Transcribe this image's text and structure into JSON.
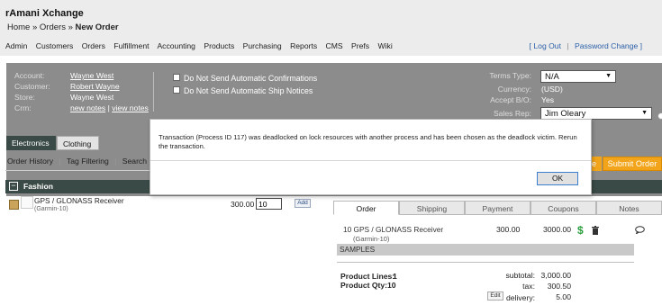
{
  "app": {
    "title": "rAmani Xchange"
  },
  "breadcrumb": {
    "home": "Home",
    "sep1": "»",
    "orders": "Orders",
    "sep2": "»",
    "current": "New Order"
  },
  "nav": {
    "items": [
      "Admin",
      "Customers",
      "Orders",
      "Fulfillment",
      "Accounting",
      "Products",
      "Purchasing",
      "Reports",
      "CMS",
      "Prefs",
      "Wiki"
    ],
    "logout": "[ Log Out",
    "sep": "|",
    "password_change": "Password Change ]"
  },
  "account": {
    "account_label": "Account:",
    "account_value": "Wayne West",
    "customer_label": "Customer:",
    "customer_value": "Robert Wayne",
    "store_label": "Store:",
    "store_value": "Wayne West",
    "crm_label": "Crm:",
    "new_notes": "new notes",
    "crm_sep": "|",
    "view_notes": "view notes"
  },
  "options": {
    "no_confirmations": "Do Not Send Automatic Confirmations",
    "no_ship_notices": "Do Not Send Automatic Ship Notices"
  },
  "terms": {
    "terms_type_label": "Terms Type:",
    "terms_type_value": "N/A",
    "currency_label": "Currency:",
    "currency_value": "(USD)",
    "accept_bo_label": "Accept B/O:",
    "accept_bo_value": "Yes",
    "sales_rep_label": "Sales Rep:",
    "sales_rep_value": "Jim Oleary"
  },
  "catalog_tabs": [
    "Electronics",
    "Clothing"
  ],
  "tools": {
    "order_history": "Order History",
    "sep": "|",
    "tag_filtering": "Tag Filtering",
    "search": "Search"
  },
  "buttons": {
    "partial": "e",
    "submit_order": "Submit Order",
    "add": "Add",
    "edit": "Edit",
    "ok": "OK"
  },
  "category": {
    "toggle": "−",
    "name": "Fashion"
  },
  "product": {
    "name": "GPS / GLONASS Receiver",
    "sku": "(Garmin-10)",
    "price": "300.00",
    "qty": "10"
  },
  "order_tabs": [
    "Order",
    "Shipping",
    "Payment",
    "Coupons",
    "Notes"
  ],
  "order_line": {
    "name": "10 GPS / GLONASS Receiver",
    "sku": "(Garmin-10)",
    "price": "300.00",
    "total": "3000.00",
    "price_icon": "$"
  },
  "samples_label": "SAMPLES",
  "summary": {
    "lines_label": "Product Lines:",
    "lines_value": "1",
    "qty_label": "Product Qty:",
    "qty_value": "10",
    "subtotal_label": "subtotal:",
    "subtotal_value": "3,000.00",
    "tax_label": "tax:",
    "tax_value": "300.50",
    "delivery_label": "delivery:",
    "delivery_value": "5.00"
  },
  "dialog": {
    "message": "Transaction (Process ID 117) was deadlocked on lock resources with another process and has been chosen as the deadlock victim. Rerun the transaction."
  },
  "colors": {
    "accent_orange": "#f2a51a",
    "dark_bar": "#3a4a46",
    "panel_gray": "#8c8c8c",
    "link_blue": "#2a5fa8",
    "dollar_green": "#2e9e3e"
  },
  "icons": [
    "fashion-collapse-icon",
    "product-box-icon",
    "dollar-icon",
    "trash-icon",
    "comment-icon",
    "dropdown-arrow-icon"
  ]
}
